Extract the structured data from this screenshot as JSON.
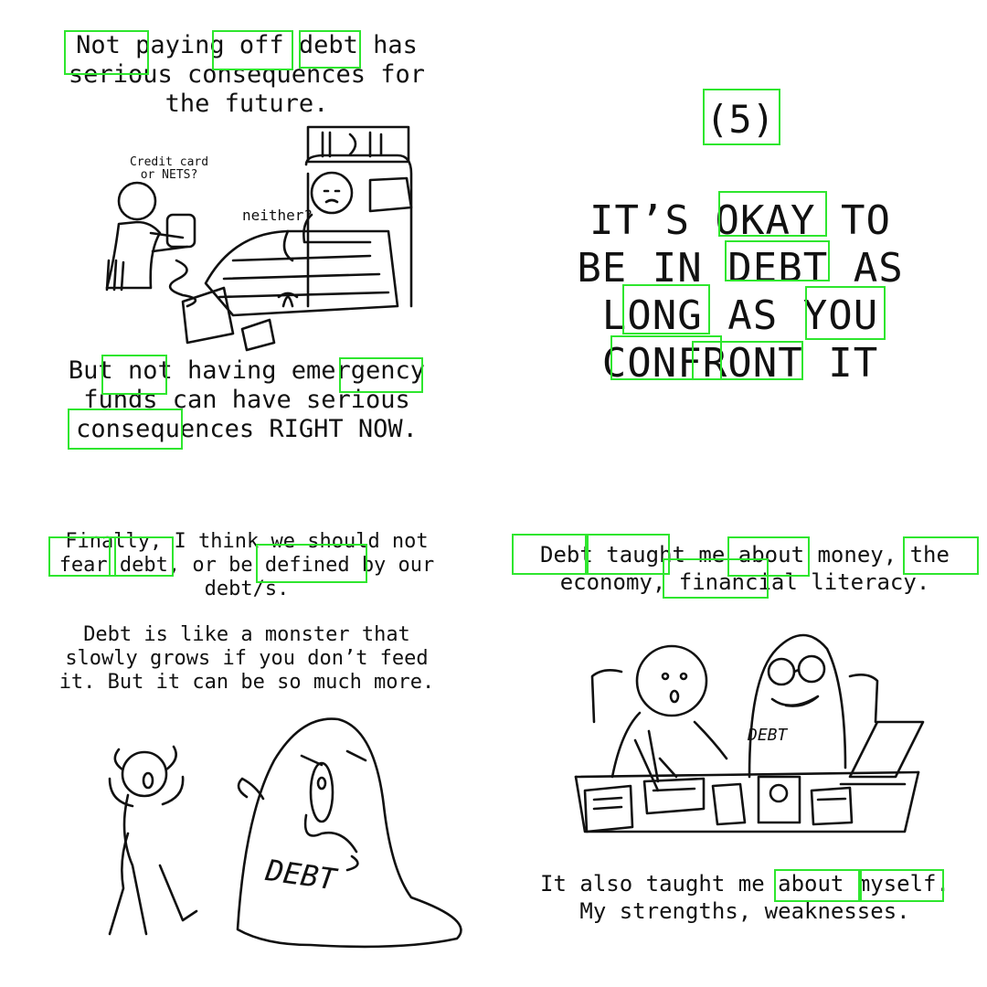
{
  "panel_top_left": {
    "top_text": "Not paying off debt has\nserious consequences for\nthe future.",
    "bottom_text": "But not having emergency\nfunds can have serious\nconsequences RIGHT NOW.",
    "speech_cashier": "Credit card\nor NETS?",
    "speech_patient": "neither?"
  },
  "panel_top_right": {
    "number": "(5)",
    "headline": "IT’S OKAY TO\nBE IN DEBT AS\nLONG AS YOU\nCONFRONT IT"
  },
  "panel_bottom_left": {
    "text_1": "Finally, I think we should not\nfear debt, or be defined by our\ndebt/s.",
    "text_2": "Debt is like a monster that\nslowly grows if you don’t feed\nit. But it can be so much more.",
    "monster_label": "DEBT"
  },
  "panel_bottom_right": {
    "text_1": "Debt taught me about money, the\neconomy, financial literacy.",
    "text_2": "It also taught me about myself.\nMy strengths, weaknesses.",
    "monster_label": "DEBT"
  },
  "highlight_color": "#2ee62e",
  "icons": [
    "hospital-bed-illustration",
    "ghost-monster-illustration",
    "study-table-illustration"
  ]
}
